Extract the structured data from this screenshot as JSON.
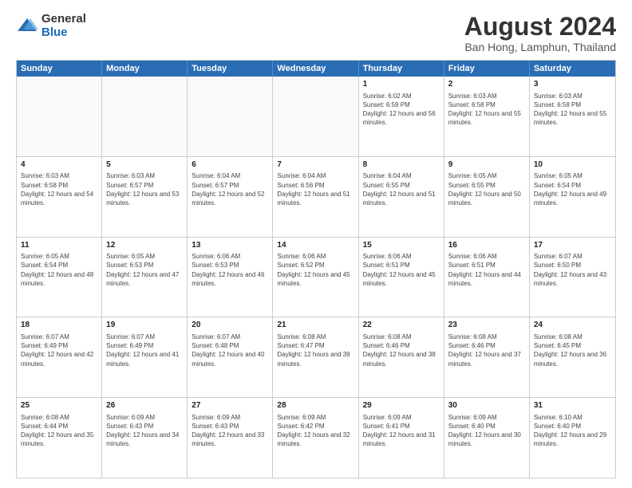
{
  "header": {
    "logo": {
      "line1": "General",
      "line2": "Blue"
    },
    "title": "August 2024",
    "subtitle": "Ban Hong, Lamphun, Thailand"
  },
  "calendar": {
    "days": [
      "Sunday",
      "Monday",
      "Tuesday",
      "Wednesday",
      "Thursday",
      "Friday",
      "Saturday"
    ],
    "rows": [
      [
        {
          "day": "",
          "empty": true
        },
        {
          "day": "",
          "empty": true
        },
        {
          "day": "",
          "empty": true
        },
        {
          "day": "",
          "empty": true
        },
        {
          "day": "1",
          "sunrise": "6:02 AM",
          "sunset": "6:59 PM",
          "daylight": "12 hours and 56 minutes."
        },
        {
          "day": "2",
          "sunrise": "6:03 AM",
          "sunset": "6:58 PM",
          "daylight": "12 hours and 55 minutes."
        },
        {
          "day": "3",
          "sunrise": "6:03 AM",
          "sunset": "6:58 PM",
          "daylight": "12 hours and 55 minutes."
        }
      ],
      [
        {
          "day": "4",
          "sunrise": "6:03 AM",
          "sunset": "6:58 PM",
          "daylight": "12 hours and 54 minutes."
        },
        {
          "day": "5",
          "sunrise": "6:03 AM",
          "sunset": "6:57 PM",
          "daylight": "12 hours and 53 minutes."
        },
        {
          "day": "6",
          "sunrise": "6:04 AM",
          "sunset": "6:57 PM",
          "daylight": "12 hours and 52 minutes."
        },
        {
          "day": "7",
          "sunrise": "6:04 AM",
          "sunset": "6:56 PM",
          "daylight": "12 hours and 51 minutes."
        },
        {
          "day": "8",
          "sunrise": "6:04 AM",
          "sunset": "6:55 PM",
          "daylight": "12 hours and 51 minutes."
        },
        {
          "day": "9",
          "sunrise": "6:05 AM",
          "sunset": "6:55 PM",
          "daylight": "12 hours and 50 minutes."
        },
        {
          "day": "10",
          "sunrise": "6:05 AM",
          "sunset": "6:54 PM",
          "daylight": "12 hours and 49 minutes."
        }
      ],
      [
        {
          "day": "11",
          "sunrise": "6:05 AM",
          "sunset": "6:54 PM",
          "daylight": "12 hours and 48 minutes."
        },
        {
          "day": "12",
          "sunrise": "6:05 AM",
          "sunset": "6:53 PM",
          "daylight": "12 hours and 47 minutes."
        },
        {
          "day": "13",
          "sunrise": "6:06 AM",
          "sunset": "6:53 PM",
          "daylight": "12 hours and 46 minutes."
        },
        {
          "day": "14",
          "sunrise": "6:06 AM",
          "sunset": "6:52 PM",
          "daylight": "12 hours and 45 minutes."
        },
        {
          "day": "15",
          "sunrise": "6:06 AM",
          "sunset": "6:51 PM",
          "daylight": "12 hours and 45 minutes."
        },
        {
          "day": "16",
          "sunrise": "6:06 AM",
          "sunset": "6:51 PM",
          "daylight": "12 hours and 44 minutes."
        },
        {
          "day": "17",
          "sunrise": "6:07 AM",
          "sunset": "6:50 PM",
          "daylight": "12 hours and 43 minutes."
        }
      ],
      [
        {
          "day": "18",
          "sunrise": "6:07 AM",
          "sunset": "6:49 PM",
          "daylight": "12 hours and 42 minutes."
        },
        {
          "day": "19",
          "sunrise": "6:07 AM",
          "sunset": "6:49 PM",
          "daylight": "12 hours and 41 minutes."
        },
        {
          "day": "20",
          "sunrise": "6:07 AM",
          "sunset": "6:48 PM",
          "daylight": "12 hours and 40 minutes."
        },
        {
          "day": "21",
          "sunrise": "6:08 AM",
          "sunset": "6:47 PM",
          "daylight": "12 hours and 39 minutes."
        },
        {
          "day": "22",
          "sunrise": "6:08 AM",
          "sunset": "6:46 PM",
          "daylight": "12 hours and 38 minutes."
        },
        {
          "day": "23",
          "sunrise": "6:08 AM",
          "sunset": "6:46 PM",
          "daylight": "12 hours and 37 minutes."
        },
        {
          "day": "24",
          "sunrise": "6:08 AM",
          "sunset": "6:45 PM",
          "daylight": "12 hours and 36 minutes."
        }
      ],
      [
        {
          "day": "25",
          "sunrise": "6:08 AM",
          "sunset": "6:44 PM",
          "daylight": "12 hours and 35 minutes."
        },
        {
          "day": "26",
          "sunrise": "6:09 AM",
          "sunset": "6:43 PM",
          "daylight": "12 hours and 34 minutes."
        },
        {
          "day": "27",
          "sunrise": "6:09 AM",
          "sunset": "6:43 PM",
          "daylight": "12 hours and 33 minutes."
        },
        {
          "day": "28",
          "sunrise": "6:09 AM",
          "sunset": "6:42 PM",
          "daylight": "12 hours and 32 minutes."
        },
        {
          "day": "29",
          "sunrise": "6:09 AM",
          "sunset": "6:41 PM",
          "daylight": "12 hours and 31 minutes."
        },
        {
          "day": "30",
          "sunrise": "6:09 AM",
          "sunset": "6:40 PM",
          "daylight": "12 hours and 30 minutes."
        },
        {
          "day": "31",
          "sunrise": "6:10 AM",
          "sunset": "6:40 PM",
          "daylight": "12 hours and 29 minutes."
        }
      ]
    ]
  }
}
